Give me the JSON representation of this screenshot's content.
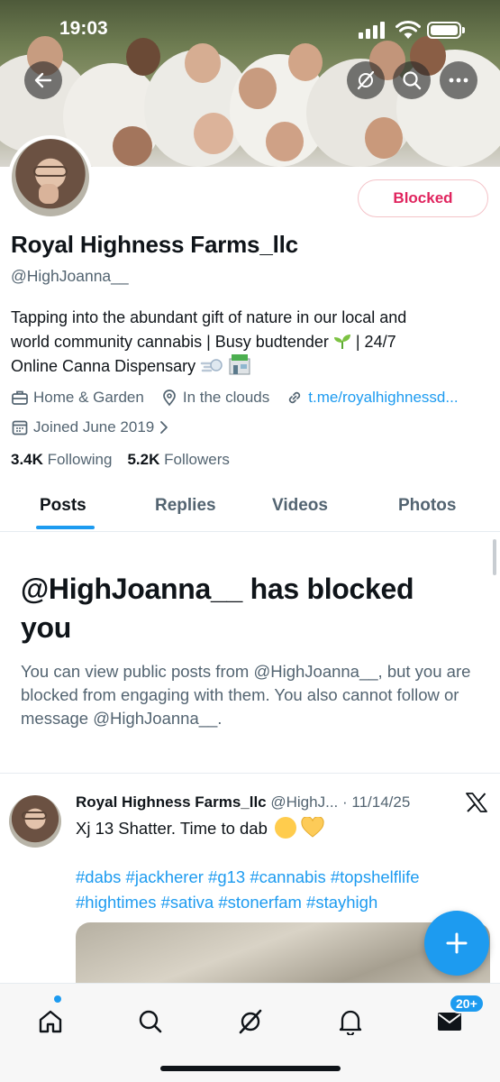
{
  "status_bar": {
    "time": "19:03"
  },
  "profile": {
    "name": "Royal Highness Farms_llc",
    "handle": "@HighJoanna__",
    "blocked_label": "Blocked",
    "bio_line1": "Tapping into the abundant gift of nature in our local and",
    "bio_line2": "world community cannabis | Busy budtender",
    "bio_line2_tail": " | 24/7",
    "bio_line3": "Online Canna Dispensary",
    "category": "Home & Garden",
    "location": "In the clouds",
    "link": "t.me/royalhighnessd...",
    "joined": "Joined June 2019",
    "following_count": "3.4K",
    "following_label": "Following",
    "followers_count": "5.2K",
    "followers_label": "Followers"
  },
  "tabs": [
    {
      "label": "Posts"
    },
    {
      "label": "Replies"
    },
    {
      "label": "Videos"
    },
    {
      "label": "Photos"
    }
  ],
  "blocked_notice": {
    "title": "@HighJoanna__ has blocked you",
    "description": "You can view public posts from @HighJoanna__, but you are blocked from engaging with them. You also cannot follow or message @HighJoanna__."
  },
  "post": {
    "author": "Royal Highness Farms_llc",
    "handle": "@HighJ...",
    "separator": " · ",
    "date": "11/14/25",
    "text": "Xj 13 Shatter. Time to dab",
    "hashtags_line1": "#dabs #jackherer #g13 #cannabis #topshelflife",
    "hashtags_line2": "#hightimes #sativa #stonerfam #stayhigh"
  },
  "nav": {
    "messages_badge": "20+"
  },
  "colors": {
    "accent": "#1d9bf0",
    "blocked_red": "#e0245e",
    "secondary_text": "#536471"
  }
}
